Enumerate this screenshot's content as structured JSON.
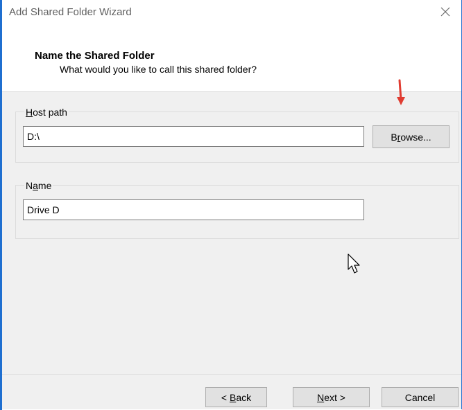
{
  "window": {
    "title": "Add Shared Folder Wizard",
    "close_glyph": "✕"
  },
  "header": {
    "title": "Name the Shared Folder",
    "subtitle": "What would you like to call this shared folder?"
  },
  "host_path_group": {
    "label_prefix": "",
    "label_access_key": "H",
    "label_rest": "ost path",
    "input_value": "D:\\",
    "browse_prefix": "B",
    "browse_access_key": "r",
    "browse_rest": "owse..."
  },
  "name_group": {
    "label_prefix": "N",
    "label_access_key": "a",
    "label_rest": "me",
    "input_value": "Drive D"
  },
  "footer": {
    "back_prefix": "< ",
    "back_access_key": "B",
    "back_rest": "ack",
    "next_prefix": "",
    "next_access_key": "N",
    "next_rest": "ext >",
    "cancel_label": "Cancel"
  },
  "colors": {
    "accent": "#1f6fd0",
    "annotation_arrow": "#e03c31",
    "dialog_background": "#f0f0f0"
  },
  "icons": {
    "close": "close-icon",
    "annotation": "red-arrow-icon",
    "cursor": "mouse-cursor-icon"
  }
}
